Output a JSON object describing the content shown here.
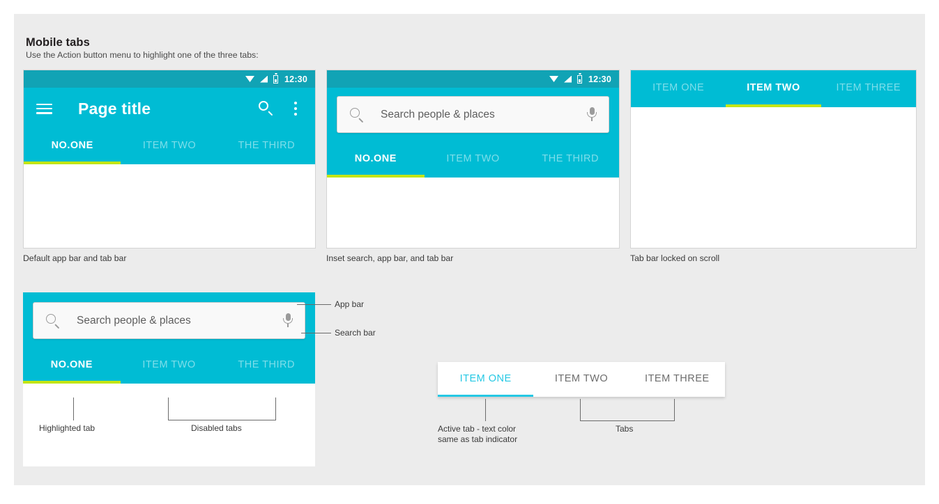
{
  "page": {
    "title": "Mobile tabs",
    "subtitle": "Use the Action button menu to highlight one of the three tabs:"
  },
  "colors": {
    "status_bar": "#11a3b5",
    "app_bar": "#00bcd4",
    "active_indicator": "#c3e515",
    "white_tab_accent": "#25c8e4",
    "inactive_tab_text": "#7fdeea",
    "panel_bg": "#ececec"
  },
  "status_bar": {
    "time": "12:30",
    "icons": [
      "wifi-icon",
      "signal-icon",
      "battery-icon"
    ]
  },
  "mock1": {
    "caption": "Default app bar and tab bar",
    "app_bar": {
      "menu_icon": "hamburger-menu-icon",
      "title": "Page title",
      "search_icon": "search-icon",
      "overflow_icon": "more-vert-icon"
    },
    "tabs": [
      {
        "label": "NO.ONE",
        "active": true
      },
      {
        "label": "ITEM TWO",
        "active": false
      },
      {
        "label": "THE THIRD",
        "active": false
      }
    ]
  },
  "mock2": {
    "caption": "Inset search, app bar, and tab bar",
    "search": {
      "placeholder": "Search people & places",
      "search_icon": "search-icon",
      "mic_icon": "microphone-icon"
    },
    "tabs": [
      {
        "label": "NO.ONE",
        "active": true
      },
      {
        "label": "ITEM TWO",
        "active": false
      },
      {
        "label": "THE THIRD",
        "active": false
      }
    ]
  },
  "mock3": {
    "caption": "Tab bar locked on scroll",
    "tabs": [
      {
        "label": "ITEM ONE",
        "active": false
      },
      {
        "label": "ITEM TWO",
        "active": true
      },
      {
        "label": "ITEM THREE",
        "active": false
      }
    ]
  },
  "mock4": {
    "search": {
      "placeholder": "Search people & places",
      "search_icon": "search-icon",
      "mic_icon": "microphone-icon"
    },
    "tabs": [
      {
        "label": "NO.ONE",
        "active": true
      },
      {
        "label": "ITEM TWO",
        "active": false
      },
      {
        "label": "THE THIRD",
        "active": false
      }
    ],
    "callouts": {
      "app_bar": "App bar",
      "search_bar": "Search bar",
      "highlighted_tab": "Highlighted tab",
      "disabled_tabs": "Disabled tabs"
    }
  },
  "mock5": {
    "tabs": [
      {
        "label": "ITEM ONE",
        "active": true
      },
      {
        "label": "ITEM TWO",
        "active": false
      },
      {
        "label": "ITEM THREE",
        "active": false
      }
    ],
    "callouts": {
      "active_tab_line1": "Active tab - text color",
      "active_tab_line2": "same as tab indicator",
      "tabs": "Tabs"
    }
  }
}
